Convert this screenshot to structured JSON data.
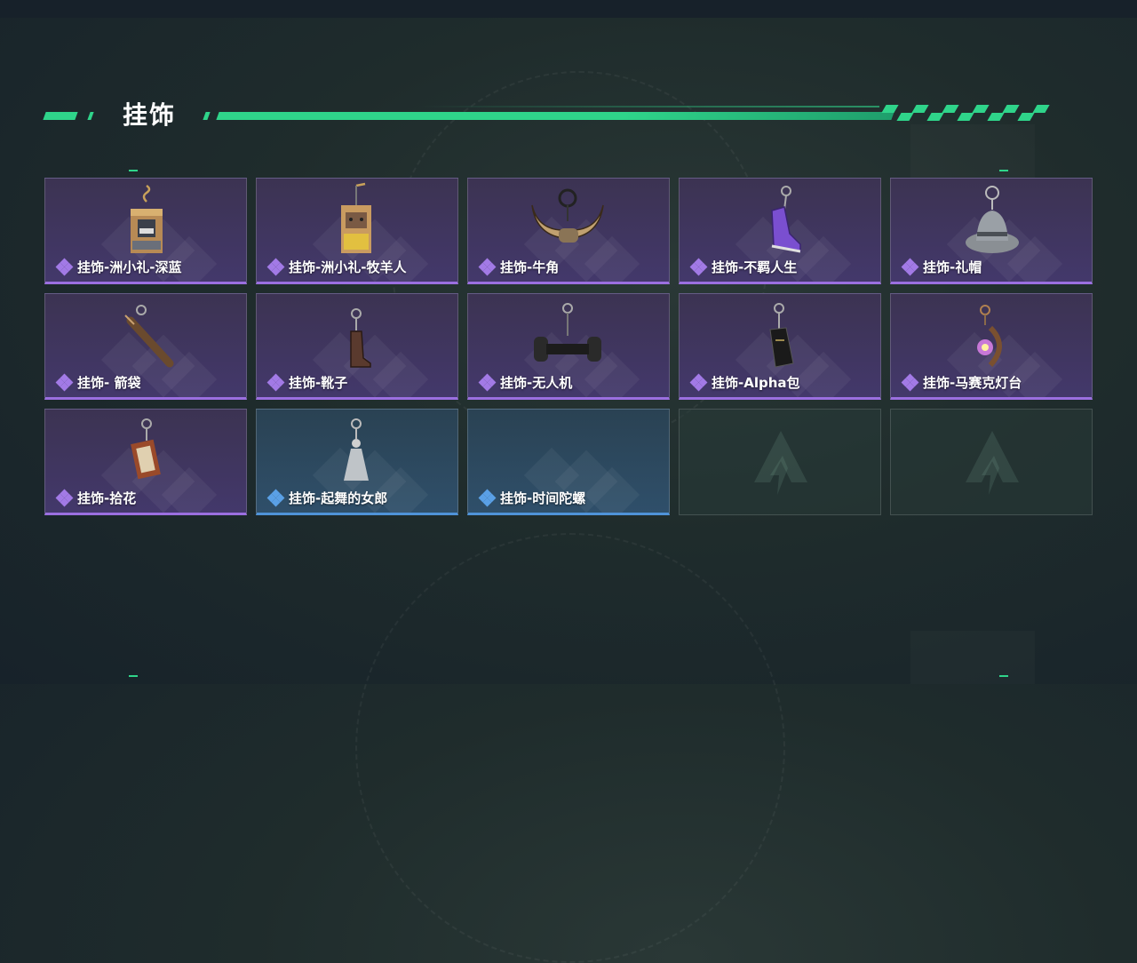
{
  "section": {
    "title": "挂饰"
  },
  "colors": {
    "accent": "#2fd48a",
    "rarity_purple": "#9b6fe0",
    "rarity_blue": "#4f93d8"
  },
  "items": [
    {
      "name": "挂饰-洲小礼-深蓝",
      "rarity": "purple",
      "icon": "gift-box-charm-icon"
    },
    {
      "name": "挂饰-洲小礼-牧羊人",
      "rarity": "purple",
      "icon": "gift-box-shepherd-charm-icon"
    },
    {
      "name": "挂饰-牛角",
      "rarity": "purple",
      "icon": "bull-horns-charm-icon"
    },
    {
      "name": "挂饰-不羁人生",
      "rarity": "purple",
      "icon": "sneaker-charm-icon"
    },
    {
      "name": "挂饰-礼帽",
      "rarity": "purple",
      "icon": "fedora-hat-charm-icon"
    },
    {
      "name": "挂饰- 箭袋",
      "rarity": "purple",
      "icon": "quiver-charm-icon"
    },
    {
      "name": "挂饰-靴子",
      "rarity": "purple",
      "icon": "boot-charm-icon"
    },
    {
      "name": "挂饰-无人机",
      "rarity": "purple",
      "icon": "drone-charm-icon"
    },
    {
      "name": "挂饰-Alpha包",
      "rarity": "purple",
      "icon": "alpha-bag-charm-icon"
    },
    {
      "name": "挂饰-马赛克灯台",
      "rarity": "purple",
      "icon": "mosaic-lamp-charm-icon"
    },
    {
      "name": "挂饰-拾花",
      "rarity": "purple",
      "icon": "picture-frame-charm-icon"
    },
    {
      "name": "挂饰-起舞的女郎",
      "rarity": "blue",
      "icon": "dancing-lady-charm-icon"
    },
    {
      "name": "挂饰-时间陀螺",
      "rarity": "blue",
      "icon": "time-top-charm-icon"
    }
  ],
  "empty_slots": 2
}
